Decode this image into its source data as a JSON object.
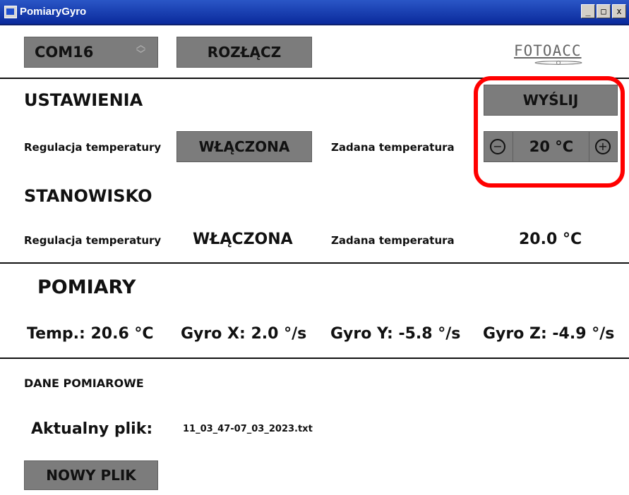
{
  "window": {
    "title": "PomiaryGyro",
    "minimize_label": "_",
    "maximize_label": "□",
    "close_label": "x"
  },
  "connection": {
    "port_value": "COM16",
    "disconnect_label": "ROZŁĄCZ",
    "logo_text": "FOTOACC"
  },
  "settings": {
    "heading": "USTAWIENIA",
    "send_label": "WYŚLIJ",
    "temp_regulation_label": "Regulacja temperatury",
    "temp_regulation_button": "WŁĄCZONA",
    "set_temp_label": "Zadana temperatura",
    "set_temp_value": "20 °C"
  },
  "station": {
    "heading": "STANOWISKO",
    "temp_regulation_label": "Regulacja temperatury",
    "temp_regulation_value": "WŁĄCZONA",
    "set_temp_label": "Zadana temperatura",
    "set_temp_value": "20.0 °C"
  },
  "measurements": {
    "heading": "POMIARY",
    "temp": "Temp.: 20.6 °C",
    "gyro_x": "Gyro X: 2.0 °/s",
    "gyro_y": "Gyro Y: -5.8 °/s",
    "gyro_z": "Gyro Z: -4.9 °/s"
  },
  "data": {
    "heading": "DANE POMIAROWE",
    "current_file_label": "Aktualny plik:",
    "current_file_value": "11_03_47-07_03_2023.txt",
    "new_file_label": "NOWY PLIK"
  },
  "colors": {
    "button_gray": "#7c7c7c",
    "highlight_red": "#ff0000",
    "titlebar_blue": "#0a2a9c"
  }
}
